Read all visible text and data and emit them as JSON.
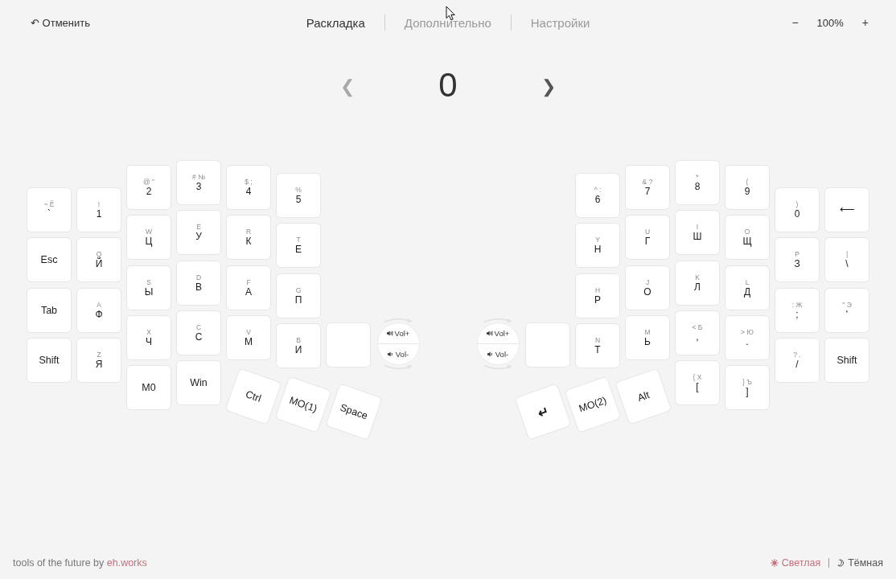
{
  "toolbar": {
    "undo": "↶ Отменить",
    "zoom": {
      "decrease": "−",
      "value": "100%",
      "increase": "+"
    }
  },
  "tabs": [
    {
      "label": "Раскладка",
      "selected": true
    },
    {
      "label": "Дополнительно",
      "selected": false
    },
    {
      "label": "Настройки",
      "selected": false
    }
  ],
  "layer_switcher": {
    "previous": {
      "label": "❮",
      "disabled": true
    },
    "layer": "0",
    "next": {
      "label": "❯",
      "disabled": false
    }
  },
  "keyboard": {
    "halves": [
      {
        "columns": [
          {
            "kind": "keys",
            "keys": [
              {
                "shifted": "~ Ё",
                "label": "`"
              },
              {
                "label": "Esc"
              },
              {
                "label": "Tab"
              },
              {
                "label": "Shift"
              }
            ]
          },
          {
            "kind": "keys",
            "keys": [
              {
                "shifted": "!",
                "label": "1"
              },
              {
                "shifted": "Q",
                "label": "Й"
              },
              {
                "shifted": "A",
                "label": "Ф"
              },
              {
                "shifted": "Z",
                "label": "Я"
              }
            ]
          },
          {
            "kind": "keys",
            "keys": [
              {
                "shifted": "@ \"",
                "label": "2"
              },
              {
                "shifted": "W",
                "label": "Ц"
              },
              {
                "shifted": "S",
                "label": "Ы"
              },
              {
                "shifted": "X",
                "label": "Ч"
              },
              {
                "label": "M0"
              }
            ]
          },
          {
            "kind": "keys",
            "keys": [
              {
                "shifted": "# №",
                "label": "3"
              },
              {
                "shifted": "E",
                "label": "У"
              },
              {
                "shifted": "D",
                "label": "В"
              },
              {
                "shifted": "C",
                "label": "С"
              },
              {
                "label": "Win"
              }
            ]
          },
          {
            "kind": "keys",
            "keys": [
              {
                "shifted": "$ ;",
                "label": "4"
              },
              {
                "shifted": "R",
                "label": "К"
              },
              {
                "shifted": "F",
                "label": "А"
              },
              {
                "shifted": "V",
                "label": "М"
              }
            ]
          },
          {
            "kind": "keys",
            "keys": [
              {
                "shifted": "%",
                "label": "5"
              },
              {
                "shifted": "T",
                "label": "Е"
              },
              {
                "shifted": "G",
                "label": "П"
              },
              {
                "shifted": "B",
                "label": "И"
              }
            ]
          },
          {
            "kind": "blank_key"
          },
          {
            "kind": "encoder",
            "up": "Vol+",
            "down": "Vol-"
          }
        ],
        "thumb_keys": [
          "Ctrl",
          "MO(1)",
          "Space"
        ]
      },
      {
        "columns": [
          {
            "kind": "encoder",
            "up": "Vol+",
            "down": "Vol-"
          },
          {
            "kind": "blank_key"
          },
          {
            "kind": "keys",
            "keys": [
              {
                "shifted": "^ :",
                "label": "6"
              },
              {
                "shifted": "Y",
                "label": "Н"
              },
              {
                "shifted": "H",
                "label": "Р"
              },
              {
                "shifted": "N",
                "label": "Т"
              }
            ]
          },
          {
            "kind": "keys",
            "keys": [
              {
                "shifted": "& ?",
                "label": "7"
              },
              {
                "shifted": "U",
                "label": "Г"
              },
              {
                "shifted": "J",
                "label": "О"
              },
              {
                "shifted": "M",
                "label": "Ь"
              }
            ]
          },
          {
            "kind": "keys",
            "keys": [
              {
                "shifted": "*",
                "label": "8"
              },
              {
                "shifted": "I",
                "label": "Ш"
              },
              {
                "shifted": "K",
                "label": "Л"
              },
              {
                "shifted": "< Б",
                "label": ","
              },
              {
                "shifted": "{ Х",
                "label": "["
              }
            ]
          },
          {
            "kind": "keys",
            "keys": [
              {
                "shifted": "(",
                "label": "9"
              },
              {
                "shifted": "O",
                "label": "Щ"
              },
              {
                "shifted": "L",
                "label": "Д"
              },
              {
                "shifted": "> Ю",
                "label": "."
              },
              {
                "shifted": "} Ъ",
                "label": "]"
              }
            ]
          },
          {
            "kind": "keys",
            "keys": [
              {
                "shifted": ")",
                "label": "0"
              },
              {
                "shifted": "P",
                "label": "З"
              },
              {
                "shifted": ": Ж",
                "label": ";"
              },
              {
                "shifted": "? .",
                "label": "/"
              }
            ]
          },
          {
            "kind": "keys",
            "keys": [
              {
                "label": "⟵"
              },
              {
                "shifted": "|",
                "label": "\\"
              },
              {
                "shifted": "\" Э",
                "label": "'"
              },
              {
                "label": "Shift"
              }
            ]
          }
        ],
        "thumb_keys": [
          "↵",
          "MO(2)",
          "Alt"
        ]
      }
    ]
  },
  "footer": {
    "credit": {
      "text": "tools of the future by",
      "link": "eh.works"
    },
    "themes": [
      {
        "kind": "light",
        "label": "Светлая",
        "selected": true
      },
      {
        "kind": "dark",
        "label": "Тёмная",
        "selected": false
      }
    ]
  }
}
